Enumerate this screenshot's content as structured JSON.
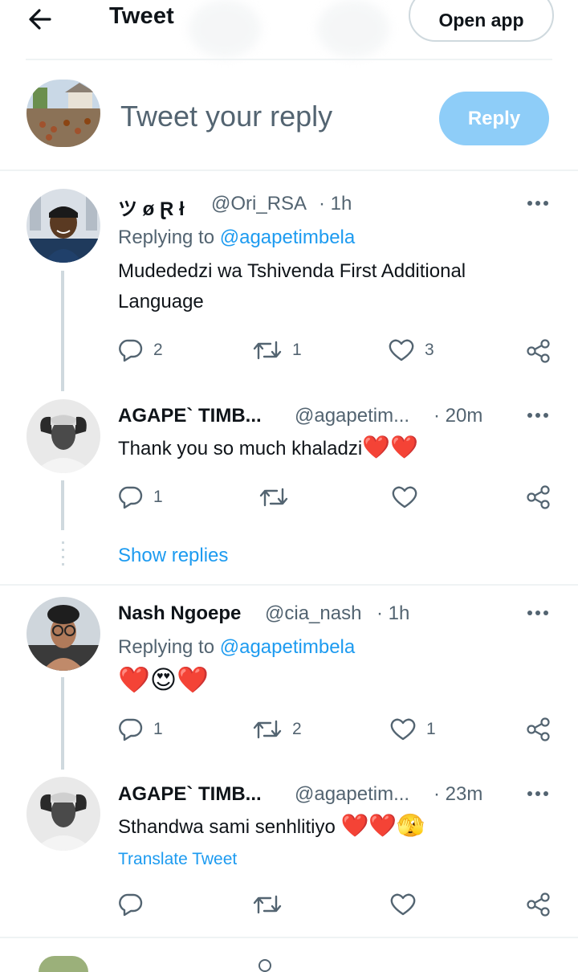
{
  "header": {
    "title": "Tweet",
    "open_app_label": "Open app"
  },
  "composer": {
    "placeholder": "Tweet your reply",
    "reply_label": "Reply"
  },
  "tweets": [
    {
      "name": "ツ ø Ɽ ł",
      "handle": "@Ori_RSA",
      "time": "· 1h",
      "replying_prefix": "Replying to",
      "replying_to": "@agapetimbela",
      "text": "Mudededzi wa Tshivenda First Additional Language",
      "replies": "2",
      "retweets": "1",
      "likes": "3"
    },
    {
      "name": "AGAPE` TIMB...",
      "handle": "@agapetim...",
      "time": "· 20m",
      "text": "Thank you so much khaladzi",
      "emoji": "❤️❤️",
      "replies": "1",
      "retweets": "",
      "likes": ""
    },
    {
      "name": "Nash Ngoepe",
      "handle": "@cia_nash",
      "time": "· 1h",
      "replying_prefix": "Replying to",
      "replying_to": "@agapetimbela",
      "text": "",
      "emoji": "❤️😍❤️",
      "replies": "1",
      "retweets": "2",
      "likes": "1"
    },
    {
      "name": "AGAPE` TIMB...",
      "handle": "@agapetim...",
      "time": "· 23m",
      "text": "Sthandwa sami senhlitiyo",
      "emoji": "❤️❤️🫣",
      "translate_label": "Translate Tweet",
      "replies": "",
      "retweets": "",
      "likes": ""
    }
  ],
  "show_replies_label": "Show replies",
  "colors": {
    "accent": "#1d9bf0",
    "reply_button_disabled": "#8ecdf8",
    "secondary_text": "#536471",
    "divider": "#eff3f4"
  },
  "icons": [
    "back-arrow-icon",
    "reply-icon",
    "retweet-icon",
    "like-icon",
    "share-icon",
    "more-icon"
  ]
}
